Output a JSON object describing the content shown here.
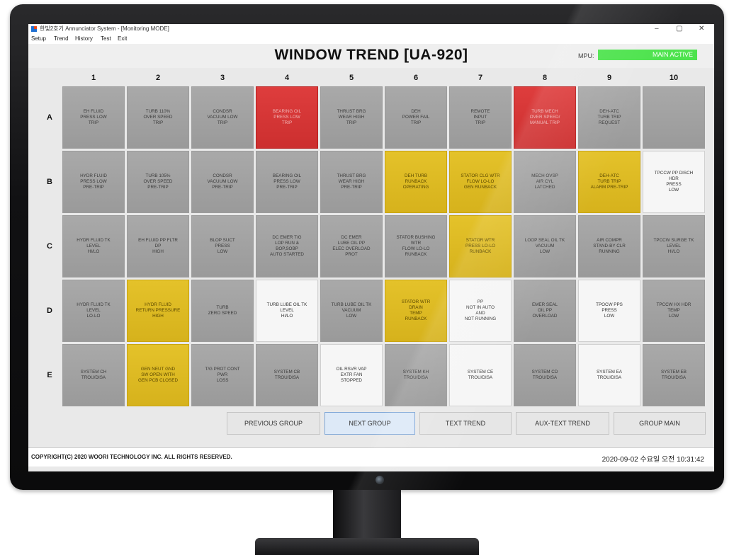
{
  "window": {
    "title": "한빛2호기 Annunciator System - [Monitoring MODE]",
    "minimize": "–",
    "maximize": "▢",
    "close": "✕"
  },
  "menu": [
    "Setup",
    "Trend",
    "History",
    "Test",
    "Exit"
  ],
  "header": {
    "title": "WINDOW TREND [UA-920]",
    "mpu_label": "MPU:",
    "mpu_status": "MAIN ACTIVE",
    "mpu_status_color": "#4ee34e"
  },
  "columns": [
    "1",
    "2",
    "3",
    "4",
    "5",
    "6",
    "7",
    "8",
    "9",
    "10"
  ],
  "rows": [
    {
      "label": "A",
      "tiles": [
        {
          "text": "EH FLUID\nPRESS LOW\nTRIP",
          "color": "gray"
        },
        {
          "text": "TURB 110%\nOVER SPEED\nTRIP",
          "color": "gray"
        },
        {
          "text": "CONDSR\nVACUUM LOW\nTRIP",
          "color": "gray"
        },
        {
          "text": "BEARING OIL\nPRESS LOW\nTRIP",
          "color": "red"
        },
        {
          "text": "THRUST BRG\nWEAR HIGH\nTRIP",
          "color": "gray"
        },
        {
          "text": "DEH\nPOWER FAIL\nTRIP",
          "color": "gray"
        },
        {
          "text": "REMOTE\nINPUT\nTRIP",
          "color": "gray"
        },
        {
          "text": "TURB MECH\nOVER SPEED/\nMANUAL TRIP",
          "color": "red"
        },
        {
          "text": "DEH-ATC\nTURB TRIP\nREQUEST",
          "color": "gray"
        },
        {
          "text": "",
          "color": "gray"
        }
      ]
    },
    {
      "label": "B",
      "tiles": [
        {
          "text": "HYDR FLUID\nPRESS LOW\nPRE-TRIP",
          "color": "gray"
        },
        {
          "text": "TURB 105%\nOVER SPEED\nPRE-TRIP",
          "color": "gray"
        },
        {
          "text": "CONDSR\nVACUUM LOW\nPRE-TRIP",
          "color": "gray"
        },
        {
          "text": "BEARING OIL\nPRESS LOW\nPRE-TRIP",
          "color": "gray"
        },
        {
          "text": "THRUST BRG\nWEAR HIGH\nPRE-TRIP",
          "color": "gray"
        },
        {
          "text": "DEH TURB\nRUNBACK\nOPERATING",
          "color": "yellow"
        },
        {
          "text": "STATOR CLG WTR\nFLOW LO-LO\nGEN RUNBACK",
          "color": "yellow"
        },
        {
          "text": "MECH OVSP\nAIR CYL\nLATCHED",
          "color": "gray"
        },
        {
          "text": "DEH-ATC\nTURB TRIP\nALARM PRE-TRIP",
          "color": "yellow"
        },
        {
          "text": "TPCCW PP DISCH\nHDR\nPRESS\nLOW",
          "color": "white"
        }
      ]
    },
    {
      "label": "C",
      "tiles": [
        {
          "text": "HYDR FLUID TK\nLEVEL\nHI/LO",
          "color": "gray"
        },
        {
          "text": "EH FLUID PP FLTR\nDP\nHIGH",
          "color": "gray"
        },
        {
          "text": "BLOP SUCT\nPRESS\nLOW",
          "color": "gray"
        },
        {
          "text": "DC EMER T/G\nLOP RUN &\nBOP,SOBP\nAUTO STARTED",
          "color": "gray"
        },
        {
          "text": "DC EMER\nLUBE OIL PP\nELEC OVERLOAD\nPROT",
          "color": "gray"
        },
        {
          "text": "STATOR BUSHING\nWTR\nFLOW LO-LO\nRUNBACK",
          "color": "gray"
        },
        {
          "text": "STATOR WTR\nPRESS LO-LO\nRUNBACK",
          "color": "yellow"
        },
        {
          "text": "LOOP SEAL OIL TK\nVACUUM\nLOW",
          "color": "gray"
        },
        {
          "text": "AIR COMPR\nSTAND-BY CLR\nRUNNING",
          "color": "gray"
        },
        {
          "text": "TPCCW SURGE TK\nLEVEL\nHI/LO",
          "color": "gray"
        }
      ]
    },
    {
      "label": "D",
      "tiles": [
        {
          "text": "HYDR FLUID TK\nLEVEL\nLO-LO",
          "color": "gray"
        },
        {
          "text": "HYDR FLUID\nRETURN PRESSURE\nHIGH",
          "color": "yellow"
        },
        {
          "text": "TURB\nZERO SPEED",
          "color": "gray"
        },
        {
          "text": "TURB LUBE OIL TK\nLEVEL\nHI/LO",
          "color": "white"
        },
        {
          "text": "TURB LUBE OIL TK\nVACUUM\nLOW",
          "color": "gray"
        },
        {
          "text": "STATOR WTR\nDRAIN\nTEMP\nRUNBACK",
          "color": "yellow"
        },
        {
          "text": "PP\nNOT IN AUTO\nAND\nNOT RUNNING",
          "color": "white"
        },
        {
          "text": "EMER SEAL\nOIL PP\nOVERLOAD",
          "color": "gray"
        },
        {
          "text": "TPOCW PPS\nPRESS\nLOW",
          "color": "white"
        },
        {
          "text": "TPCCW HX HDR\nTEMP\nLOW",
          "color": "gray"
        }
      ]
    },
    {
      "label": "E",
      "tiles": [
        {
          "text": "SYSTEM CH\nTROU/DISA",
          "color": "gray"
        },
        {
          "text": "GEN NEUT GND\nSW OPEN WITH\nGEN PCB CLOSED",
          "color": "yellow"
        },
        {
          "text": "T/G PROT CONT\nPWR\nLOSS",
          "color": "gray"
        },
        {
          "text": "SYSTEM CB\nTROU/DISA",
          "color": "gray"
        },
        {
          "text": "OIL RSVR VAP\nEXTR FAN\nSTOPPED",
          "color": "white"
        },
        {
          "text": "SYSTEM KH\nTROU/DISA",
          "color": "gray"
        },
        {
          "text": "SYSTEM CE\nTROU/DISA",
          "color": "white"
        },
        {
          "text": "SYSTEM CD\nTROU/DISA",
          "color": "gray"
        },
        {
          "text": "SYSTEM EA\nTROU/DISA",
          "color": "white"
        },
        {
          "text": "SYSTEM EB\nTROU/DISA",
          "color": "gray"
        }
      ]
    }
  ],
  "buttons": {
    "previous_group": "PREVIOUS GROUP",
    "next_group": "NEXT GROUP",
    "text_trend": "TEXT TREND",
    "aux_text_trend": "AUX-TEXT TREND",
    "group_main": "GROUP MAIN"
  },
  "footer": {
    "copyright": "COPYRIGHT(C) 2020 WOORI TECHNOLOGY INC. ALL RIGHTS RESERVED.",
    "datetime": "2020-09-02 수요일 오전 10:31:42"
  }
}
